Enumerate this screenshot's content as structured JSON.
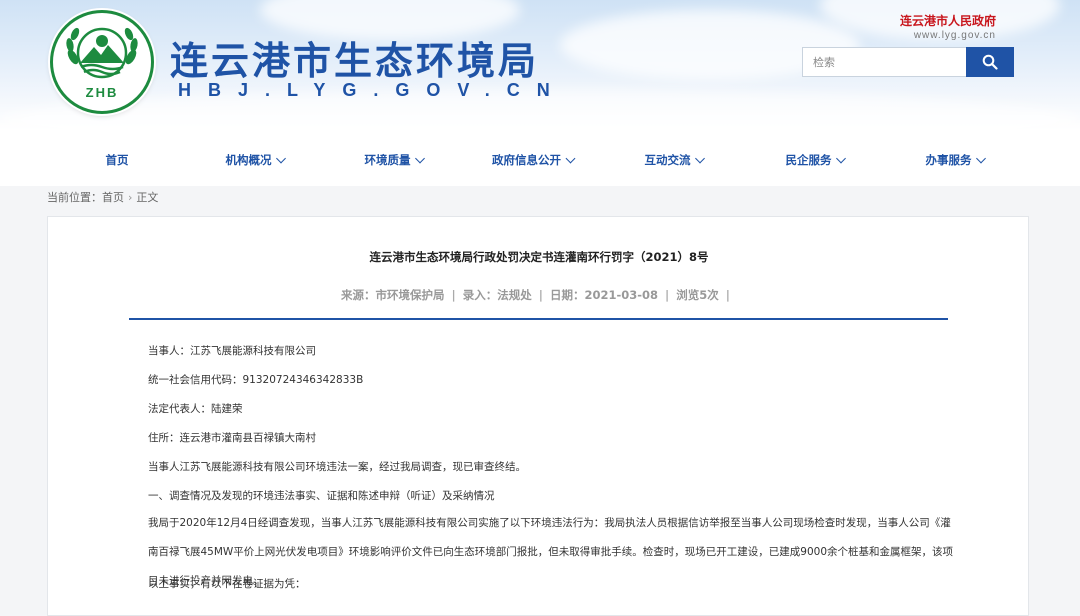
{
  "header": {
    "site_title": "连云港市生态环境局",
    "site_domain": "HBJ.LYG.GOV.CN",
    "logo_text": "ZHB",
    "gov_name": "连云港市人民政府",
    "gov_url": "www.lyg.gov.cn",
    "search_placeholder": "检索"
  },
  "nav": {
    "items": [
      {
        "label": "首页",
        "dropdown": false
      },
      {
        "label": "机构概况",
        "dropdown": true
      },
      {
        "label": "环境质量",
        "dropdown": true
      },
      {
        "label": "政府信息公开",
        "dropdown": true
      },
      {
        "label": "互动交流",
        "dropdown": true
      },
      {
        "label": "民企服务",
        "dropdown": true
      },
      {
        "label": "办事服务",
        "dropdown": true
      }
    ]
  },
  "breadcrumb": {
    "prefix": "当前位置：",
    "home": "首页",
    "current": "正文"
  },
  "article": {
    "title": "连云港市生态环境局行政处罚决定书连灌南环行罚字（2021）8号",
    "meta": {
      "source": "来源：市环境保护局",
      "entry": "录入：法规处",
      "date": "日期：2021-03-08",
      "views": "浏览5次"
    },
    "paragraphs": [
      "当事人：江苏飞展能源科技有限公司",
      "统一社会信用代码：91320724346342833B",
      "法定代表人：陆建荣",
      "住所：连云港市灌南县百禄镇大南村",
      "当事人江苏飞展能源科技有限公司环境违法一案，经过我局调查，现已审查终结。",
      "一、调查情况及发现的环境违法事实、证据和陈述申辩（听证）及采纳情况",
      "我局于2020年12月4日经调查发现，当事人江苏飞展能源科技有限公司实施了以下环境违法行为：我局执法人员根据信访举报至当事人公司现场检查时发现，当事人公司《灌南百禄飞展45MW平价上网光伏发电项目》环境影响评价文件已向生态环境部门报批，但未取得审批手续。检查时，现场已开工建设，已建成9000余个桩基和金属框架，该项目未进行投产并网发电。",
      "以上事实，有以下在卷证据为凭："
    ]
  },
  "colors": {
    "brand_blue": "#1f53a6",
    "gov_red": "#c8161d",
    "logo_green": "#1d8b3f"
  }
}
